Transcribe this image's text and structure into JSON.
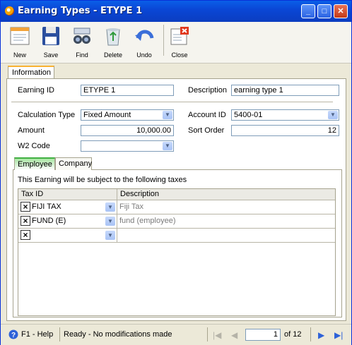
{
  "window": {
    "title": "Earning Types - ETYPE 1"
  },
  "toolbar": {
    "items": [
      {
        "label": "New",
        "icon": "new-document-icon"
      },
      {
        "label": "Save",
        "icon": "floppy-disk-icon"
      },
      {
        "label": "Find",
        "icon": "binoculars-icon"
      },
      {
        "label": "Delete",
        "icon": "recycle-bin-icon"
      },
      {
        "label": "Undo",
        "icon": "undo-arrow-icon"
      },
      {
        "label": "Close",
        "icon": "close-form-icon"
      }
    ]
  },
  "tabs": {
    "information": "Information"
  },
  "form": {
    "earning_id_label": "Earning ID",
    "earning_id": "ETYPE 1",
    "description_label": "Description",
    "description": "earning type 1",
    "calc_type_label": "Calculation Type",
    "calc_type": "Fixed Amount",
    "account_id_label": "Account ID",
    "account_id": "5400-01",
    "amount_label": "Amount",
    "amount": "10,000.00",
    "sort_order_label": "Sort Order",
    "sort_order": "12",
    "w2_code_label": "W2 Code",
    "w2_code": ""
  },
  "subtabs": {
    "employee": "Employee",
    "company": "Company"
  },
  "taxes": {
    "caption": "This Earning will be subject to the following taxes",
    "col_tax_id": "Tax ID",
    "col_description": "Description",
    "rows": [
      {
        "tax_id": "FIJI TAX",
        "description": "Fiji Tax"
      },
      {
        "tax_id": "FUND (E)",
        "description": "fund (employee)"
      },
      {
        "tax_id": "",
        "description": ""
      }
    ]
  },
  "status": {
    "help": "F1 - Help",
    "message": "Ready - No modifications made",
    "page": "1",
    "of_label": "of 12"
  },
  "colors": {
    "title_bar": "#0a47d6",
    "active_tab": "#41b043",
    "tab_highlight": "#f9b233"
  }
}
